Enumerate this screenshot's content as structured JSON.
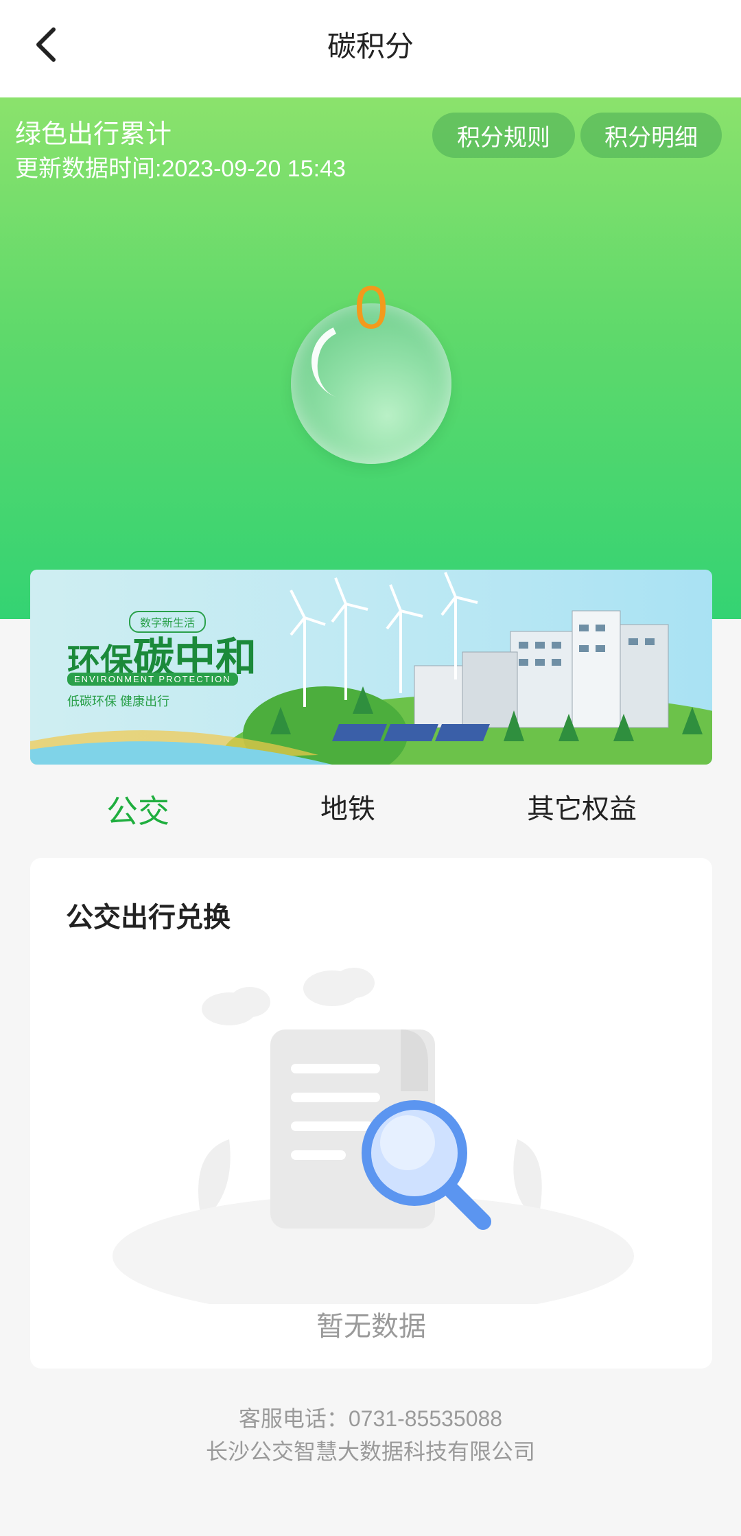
{
  "header": {
    "title": "碳积分",
    "back_icon": "chevron-left-icon"
  },
  "hero": {
    "title": "绿色出行累计",
    "updated_label": "更新数据时间:2023-09-20 15:43",
    "points": "0",
    "rules_button": "积分规则",
    "detail_button": "积分明细",
    "accent_color": "#f39a1c"
  },
  "banner": {
    "tag": "数字新生活",
    "title_small": "环保",
    "title_big": "碳中和",
    "subtitle_en": "ENVIRONMENT PROTECTION",
    "subtitle_cn": "低碳环保 健康出行"
  },
  "tabs": [
    {
      "label": "公交",
      "active": true
    },
    {
      "label": "地铁",
      "active": false
    },
    {
      "label": "其它权益",
      "active": false
    }
  ],
  "card": {
    "title": "公交出行兑换",
    "empty_text": "暂无数据",
    "empty_icon": "document-search-icon"
  },
  "footer": {
    "phone": "客服电话：0731-85535088",
    "company": "长沙公交智慧大数据科技有限公司"
  },
  "colors": {
    "primary_green": "#1fae3e",
    "hero_top": "#8be26c",
    "hero_bottom": "#34d373"
  }
}
